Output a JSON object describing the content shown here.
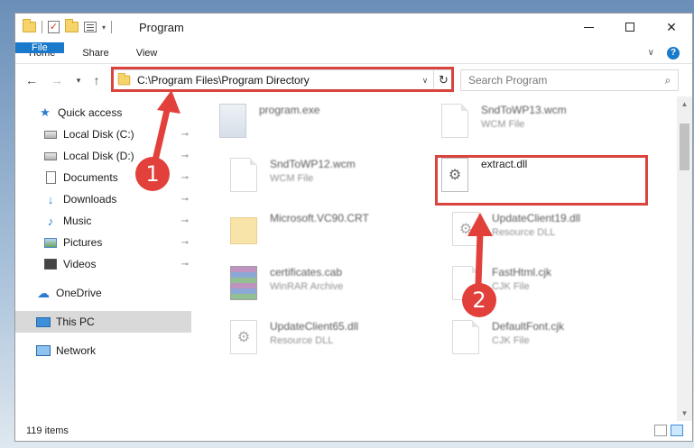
{
  "window": {
    "title": "Program",
    "minimize": "—",
    "maximize": "",
    "close": "✕"
  },
  "ribbon": {
    "tabs": [
      "File",
      "Home",
      "Share",
      "View"
    ],
    "expand_icon": "chevron-down-icon",
    "help": "?"
  },
  "nav": {
    "back": "←",
    "forward": "→",
    "recent": "▾",
    "up": "↑",
    "address": "C:\\Program Files\\Program Directory",
    "address_dropdown": "∨",
    "refresh": "↻",
    "search_placeholder": "Search Program",
    "search_icon": "⌕"
  },
  "sidebar": {
    "items": [
      {
        "label": "Quick access",
        "icon": "star-icon",
        "pinned": false
      },
      {
        "label": "Local Disk (C:)",
        "icon": "drive-icon",
        "pinned": true
      },
      {
        "label": "Local Disk (D:)",
        "icon": "drive-icon",
        "pinned": true
      },
      {
        "label": "Documents",
        "icon": "document-icon",
        "pinned": true
      },
      {
        "label": "Downloads",
        "icon": "download-icon",
        "pinned": true
      },
      {
        "label": "Music",
        "icon": "music-icon",
        "pinned": true
      },
      {
        "label": "Pictures",
        "icon": "pictures-icon",
        "pinned": true
      },
      {
        "label": "Videos",
        "icon": "videos-icon",
        "pinned": true
      },
      {
        "label": "OneDrive",
        "icon": "cloud-icon",
        "pinned": false
      },
      {
        "label": "This PC",
        "icon": "computer-icon",
        "pinned": false,
        "selected": true
      },
      {
        "label": "Network",
        "icon": "network-icon",
        "pinned": false
      }
    ],
    "pin_glyph": "📌"
  },
  "files": [
    {
      "name": "program.exe",
      "type": "",
      "icon": "exe-icon"
    },
    {
      "name": "SndToWP13.wcm",
      "type": "WCM File",
      "icon": "generic-file-icon"
    },
    {
      "name": "SndToWP12.wcm",
      "type": "WCM File",
      "icon": "generic-file-icon"
    },
    {
      "name": "extract.dll",
      "type": "",
      "icon": "dll-icon"
    },
    {
      "name": "Microsoft.VC90.CRT",
      "type": "",
      "icon": "folder-icon"
    },
    {
      "name": "UpdateClient19.dll",
      "type": "Resource DLL",
      "icon": "dll-icon"
    },
    {
      "name": "certificates.cab",
      "type": "WinRAR Archive",
      "icon": "archive-icon"
    },
    {
      "name": "FastHtml.cjk",
      "type": "CJK File",
      "icon": "generic-file-icon"
    },
    {
      "name": "UpdateClient65.dll",
      "type": "Resource DLL",
      "icon": "dll-icon"
    },
    {
      "name": "DefaultFont.cjk",
      "type": "CJK File",
      "icon": "generic-file-icon"
    }
  ],
  "status": {
    "item_count": "119 items"
  },
  "annotations": {
    "callout_1": "1",
    "callout_2": "2",
    "highlight_color": "#d9443e"
  }
}
